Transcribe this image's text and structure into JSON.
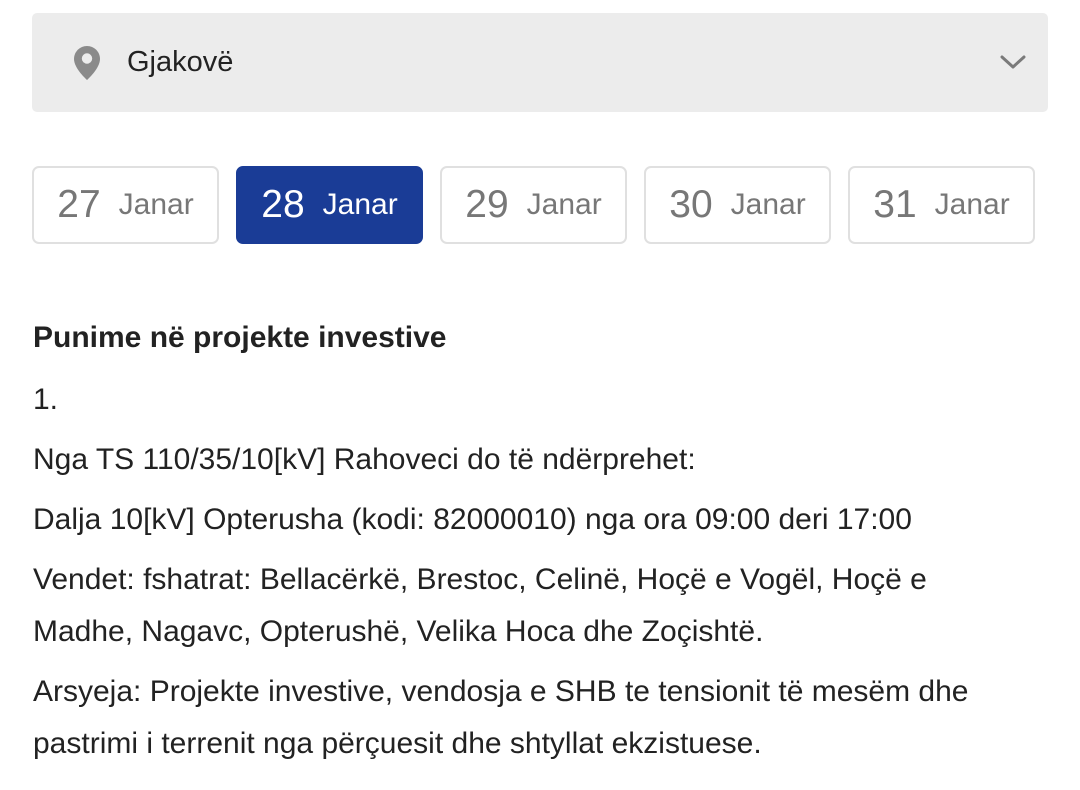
{
  "location": {
    "selected": "Gjakovë",
    "icon": "map-pin-icon",
    "dropdown_icon": "chevron-down-icon"
  },
  "dates": [
    {
      "day": "27",
      "month": "Janar",
      "active": false
    },
    {
      "day": "28",
      "month": "Janar",
      "active": true
    },
    {
      "day": "29",
      "month": "Janar",
      "active": false
    },
    {
      "day": "30",
      "month": "Janar",
      "active": false
    },
    {
      "day": "31",
      "month": "Janar",
      "active": false
    }
  ],
  "colors": {
    "accent": "#1a3c96",
    "select_bg": "#ececec"
  },
  "notice": {
    "title": "Punime në projekte investive",
    "number": "1.",
    "source": "Nga TS 110/35/10[kV] Rahoveci do të ndërprehet:",
    "line": "Dalja 10[kV] Opterusha (kodi: 82000010)  nga ora 09:00 deri 17:00",
    "places": "Vendet: fshatrat: Bellacërkë, Brestoc, Celinë, Hoçë e Vogël, Hoçë e Madhe, Nagavc, Opterushë, Velika Hoca dhe Zoçishtë.",
    "reason": "Arsyeja: Projekte investive,  vendosja e SHB te tensionit të mesëm dhe pastrimi i terrenit nga përçuesit dhe shtyllat ekzistuese."
  }
}
